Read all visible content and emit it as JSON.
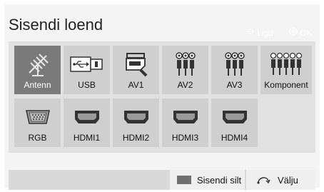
{
  "title": "Sisendi loend",
  "hints": {
    "move": "Ligu",
    "ok": "OK"
  },
  "inputs_row1": [
    {
      "label": "Antenn",
      "icon": "antenna-icon",
      "selected": true
    },
    {
      "label": "USB",
      "icon": "usb-icon",
      "selected": false
    },
    {
      "label": "AV1",
      "icon": "scart-icon",
      "selected": false
    },
    {
      "label": "AV2",
      "icon": "rca-av-icon",
      "selected": false
    },
    {
      "label": "AV3",
      "icon": "rca-av-icon",
      "selected": false
    },
    {
      "label": "Komponent",
      "icon": "component-icon",
      "selected": false
    }
  ],
  "inputs_row2": [
    {
      "label": "RGB",
      "icon": "vga-icon",
      "selected": false
    },
    {
      "label": "HDMI1",
      "icon": "hdmi-icon",
      "selected": false
    },
    {
      "label": "HDMI2",
      "icon": "hdmi-icon",
      "selected": false
    },
    {
      "label": "HDMI3",
      "icon": "hdmi-icon",
      "selected": false
    },
    {
      "label": "HDMI4",
      "icon": "hdmi-icon",
      "selected": false
    }
  ],
  "footer": {
    "input_label_button": "Sisendi silt",
    "exit_button": "Välju"
  },
  "colors": {
    "selected_tile": "#7a7a7a",
    "tile": "#cfcfcf",
    "grid_background": "#e1e1e1"
  }
}
